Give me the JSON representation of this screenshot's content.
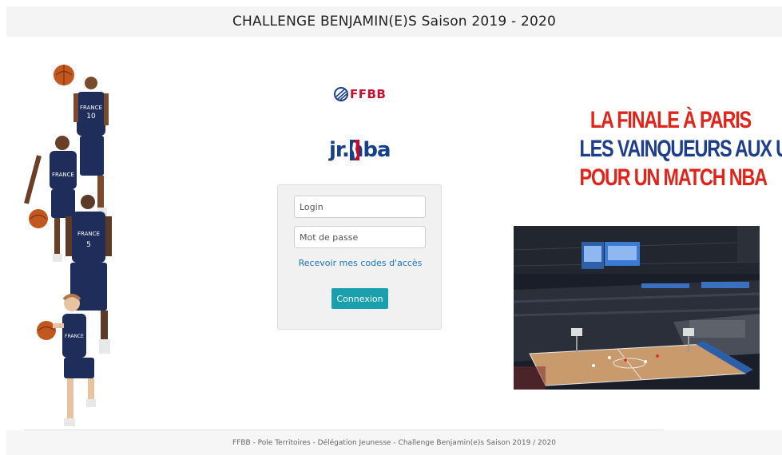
{
  "header": {
    "title": "CHALLENGE BENJAMIN(E)S Saison 2019 - 2020"
  },
  "logos": {
    "ffbb": {
      "text": "FFBB",
      "icon": "ffbb-ball-icon"
    },
    "jrnba": {
      "text": "jr.nba",
      "icon": "nba-silhouette-icon"
    }
  },
  "login": {
    "login_placeholder": "Login",
    "password_placeholder": "Mot de passe",
    "recover_link": "Recevoir mes codes d'accès",
    "submit_label": "Connexion"
  },
  "promo": {
    "lines": [
      "LA FINALE À PARIS",
      "LES VAINQUEURS AUX USA",
      "POUR UN MATCH NBA"
    ]
  },
  "footer": {
    "text": "FFBB - Pole Territoires - Délégation Jeunesse - Challenge Benjamin(e)s Saison 2019 / 2020"
  },
  "colors": {
    "accent": "#1a9fae",
    "link": "#1a73c9",
    "promo_red": "#e2231a",
    "promo_blue": "#1d3e8c",
    "ffbb_red": "#c8102e",
    "nba_blue": "#17408b"
  }
}
